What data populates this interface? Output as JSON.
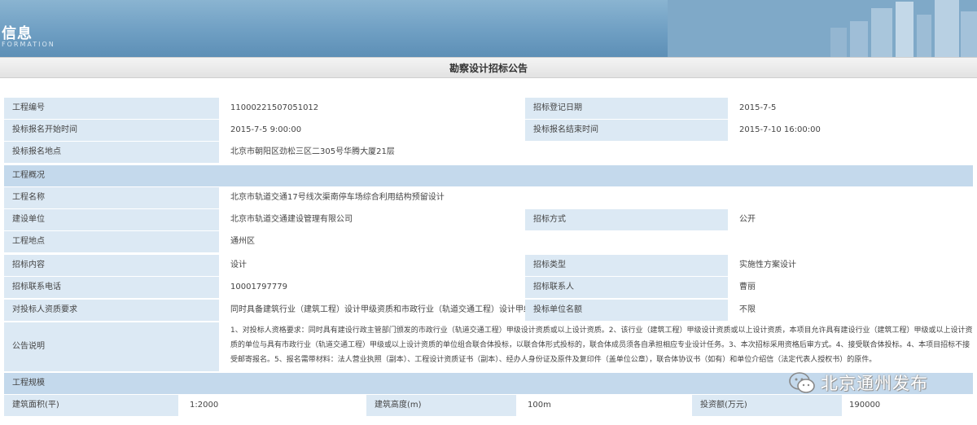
{
  "banner": {
    "title": "信息",
    "subtitle": "FORMATION"
  },
  "notice": {
    "title": "勘察设计招标公告"
  },
  "fields": {
    "project_no": {
      "label": "工程编号",
      "value": "11000221507051012"
    },
    "reg_date": {
      "label": "招标登记日期",
      "value": "2015-7-5"
    },
    "signup_start": {
      "label": "投标报名开始时间",
      "value": "2015-7-5 9:00:00"
    },
    "signup_end": {
      "label": "投标报名结束时间",
      "value": "2015-7-10 16:00:00"
    },
    "signup_place": {
      "label": "投标报名地点",
      "value": "北京市朝阳区劲松三区二305号华腾大厦21层"
    },
    "overview": {
      "label": "工程概况"
    },
    "project_name": {
      "label": "工程名称",
      "value": "北京市轨道交通17号线次渠南停车场综合利用结构预留设计"
    },
    "owner": {
      "label": "建设单位",
      "value": "北京市轨道交通建设管理有限公司"
    },
    "bid_method": {
      "label": "招标方式",
      "value": "公开"
    },
    "location": {
      "label": "工程地点",
      "value": "通州区"
    },
    "content": {
      "label": "招标内容",
      "value": "设计"
    },
    "bid_type": {
      "label": "招标类型",
      "value": "实施性方案设计"
    },
    "contact_phone": {
      "label": "招标联系电话",
      "value": "10001797779"
    },
    "contact_person": {
      "label": "招标联系人",
      "value": "曹丽"
    },
    "qualification": {
      "label": "对投标人资质要求",
      "value": "同时具备建筑行业（建筑工程）设计甲级资质和市政行业（轨道交通工程）设计甲级资质"
    },
    "bid_count": {
      "label": "投标单位名额",
      "value": "不限"
    },
    "announce": {
      "label": "公告说明",
      "value": "1、对投标人资格要求：同时具有建设行政主管部门颁发的市政行业（轨道交通工程）甲级设计资质或以上设计资质。2、该行业（建筑工程）甲级设计资质或以上设计资质，本项目允许具有建设行业（建筑工程）甲级或以上设计资质的单位与具有市政行业（轨道交通工程）甲级或以上设计资质的单位组合联合体投标，以联合体形式投标的，联合体成员须各自承担相应专业设计任务。3、本次招标采用资格后审方式。4、接受联合体投标。4、本项目招标不接受邮寄报名。5、报名需带材料：法人营业执照（副本）、工程设计资质证书（副本）、经办人身份证及原件及复印件（盖单位公章），联合体协议书（如有）和单位介绍信（法定代表人授权书）的原件。"
    },
    "scale": {
      "label": "工程规模"
    },
    "area": {
      "label": "建筑面积(平)",
      "value": "1:2000"
    },
    "height": {
      "label": "建筑高度(m)",
      "value": "100m"
    },
    "investment": {
      "label": "投资额(万元)",
      "value": "190000"
    }
  },
  "watermark": {
    "text": "北京通州发布",
    "icon": "wechat-icon"
  },
  "colors": {
    "label_bg": "#dce9f4",
    "section_bg": "#c4d9ec",
    "banner_blue": "#6f9fc3"
  }
}
